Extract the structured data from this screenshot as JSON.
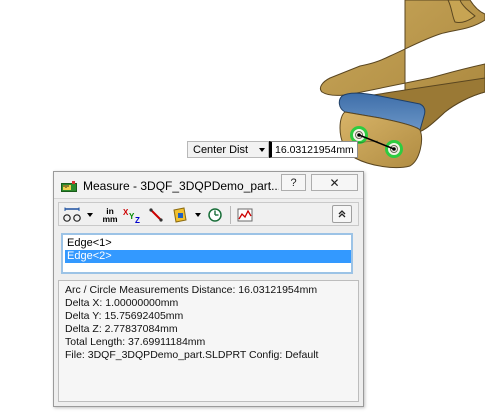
{
  "callout": {
    "type_label": "Center Dist",
    "value": "16.03121954mm"
  },
  "dialog": {
    "title": "Measure - 3DQF_3DQPDemo_part....",
    "help_label": "?",
    "close_label": "✕",
    "selections": [
      "Edge<1>",
      "Edge<2>"
    ],
    "selected_index": 1,
    "results": [
      "Arc / Circle Measurements Distance: 16.03121954mm",
      "Delta X: 1.00000000mm",
      "Delta Y: 15.75692405mm",
      "Delta Z: 2.77837084mm",
      "Total Length: 37.69911184mm",
      "File: 3DQF_3DQPDemo_part.SLDPRT Config: Default"
    ],
    "toolbar": {
      "units_in": "in",
      "units_mm": "mm",
      "xyz_label": "XYZ"
    }
  },
  "colors": {
    "part_body": "#b8964a",
    "part_edge": "#5a4620",
    "flange": "#3d6da8",
    "edge_highlight": "#2ecc40",
    "selection": "#3399ff"
  }
}
